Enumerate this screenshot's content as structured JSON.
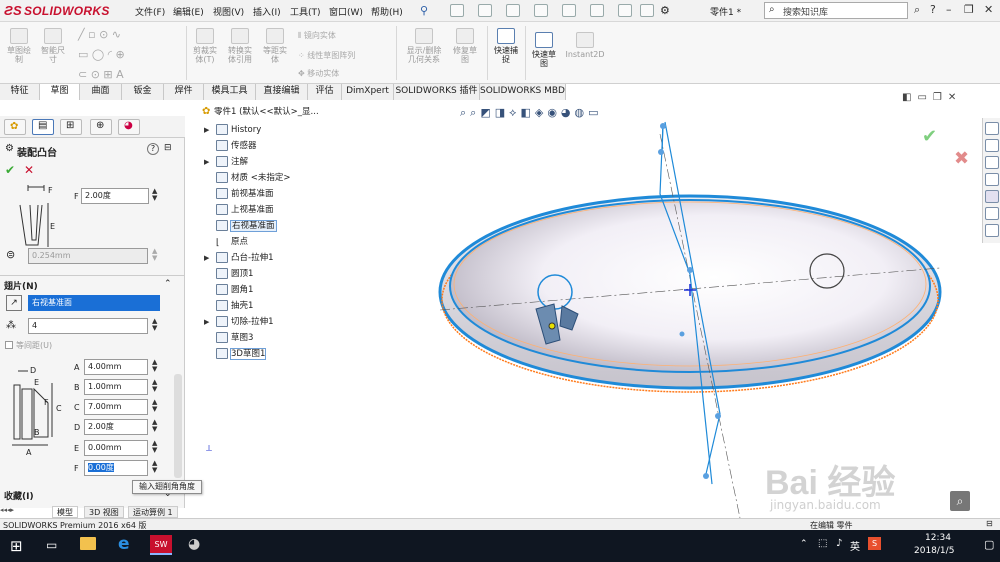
{
  "app": {
    "logo": "SOLIDWORKS",
    "doc_title": "零件1 *"
  },
  "menu": [
    "文件(F)",
    "编辑(E)",
    "视图(V)",
    "插入(I)",
    "工具(T)",
    "窗口(W)",
    "帮助(H)"
  ],
  "search": {
    "placeholder": "搜索知识库"
  },
  "ribbon": {
    "buttons": [
      {
        "label": "草图绘\n制"
      },
      {
        "label": "智能尺\n寸"
      },
      {
        "label": "剪裁实\n体(T)"
      },
      {
        "label": "转换实\n体引用"
      },
      {
        "label": "等距实\n体"
      },
      {
        "label": "显示/删除\n几何关系"
      },
      {
        "label": "修复草\n图"
      },
      {
        "label": "快速捕\n捉"
      },
      {
        "label": "快速草\n图"
      },
      {
        "label": "Instant2D"
      }
    ],
    "small": [
      "镜向实体",
      "线性草图阵列",
      "移动实体"
    ]
  },
  "tabs": [
    "特征",
    "草图",
    "曲面",
    "钣金",
    "焊件",
    "模具工具",
    "直接编辑",
    "评估",
    "DimXpert",
    "SOLIDWORKS 插件",
    "SOLIDWORKS MBD"
  ],
  "active_tab": "草图",
  "property_manager": {
    "title": "装配凸台",
    "angle1": "2.00度",
    "thickness": "0.254mm",
    "fin_section": "翅片(N)",
    "plane": "右视基准面",
    "count": "4",
    "equal_spacing": "等间距(U)",
    "params": [
      {
        "key": "A",
        "value": "4.00mm"
      },
      {
        "key": "B",
        "value": "1.00mm"
      },
      {
        "key": "C",
        "value": "7.00mm"
      },
      {
        "key": "D",
        "value": "2.00度"
      },
      {
        "key": "E",
        "value": "0.00mm"
      },
      {
        "key": "F",
        "value": "0.00度"
      }
    ],
    "favorites": "收藏(I)"
  },
  "tooltip": "输入翅削角角度",
  "bottom_tabs": [
    "模型",
    "3D 视图",
    "运动算例 1"
  ],
  "tree": {
    "root": "零件1 (默认<<默认>_显...",
    "items": [
      "History",
      "传感器",
      "注解",
      "材质 <未指定>",
      "前视基准面",
      "上视基准面",
      "右视基准面",
      "原点",
      "凸台-拉伸1",
      "圆顶1",
      "圆角1",
      "抽壳1",
      "切除-拉伸1",
      "草图3",
      "3D草图1"
    ]
  },
  "status": {
    "left": "SOLIDWORKS Premium 2016 x64 版",
    "right": "在编辑 零件"
  },
  "taskbar": {
    "time": "12:34",
    "date": "2018/1/5",
    "ime": "英"
  },
  "colors": {
    "accent": "#1f8ad8",
    "selection": "#1a6fd6",
    "orange": "#ff7a1a",
    "red": "#c8102e",
    "green": "#3aaa35"
  },
  "watermark": {
    "text": "Bai 经验",
    "url": "jingyan.baidu.com"
  }
}
